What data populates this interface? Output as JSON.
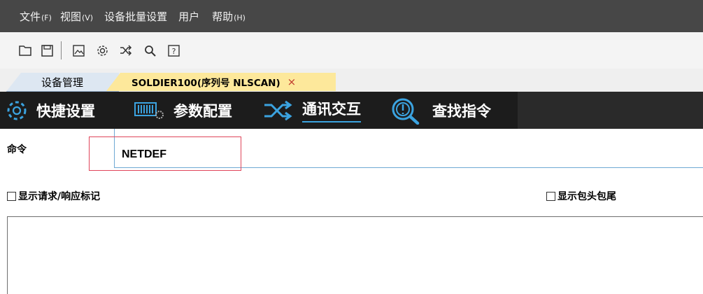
{
  "menu": [
    {
      "label": "文件",
      "accel": "(F)"
    },
    {
      "label": "视图",
      "accel": "(V)"
    },
    {
      "label": "设备批量设置",
      "accel": ""
    },
    {
      "label": "用户",
      "accel": ""
    },
    {
      "label": "帮助",
      "accel": "(H)"
    }
  ],
  "toolbar": {
    "icons": [
      "folder-icon",
      "save-icon",
      "image-icon",
      "gear-icon",
      "shuffle-icon",
      "search-icon",
      "help-icon"
    ]
  },
  "tabs": {
    "device_mgmt": "设备管理",
    "active_device": "SOLDIER100(序列号 NLSCAN)",
    "close": "×"
  },
  "function_tabs": [
    {
      "label": "快捷设置",
      "icon": "gear-icon"
    },
    {
      "label": "参数配置",
      "icon": "barcode-config-icon"
    },
    {
      "label": "通讯交互",
      "icon": "shuffle-icon",
      "active": true
    },
    {
      "label": "查找指令",
      "icon": "search-icon"
    }
  ],
  "command": {
    "label": "命令",
    "value": "NETDEF"
  },
  "options": {
    "show_req_resp": "显示请求/响应标记",
    "show_header_footer": "显示包头包尾"
  },
  "colors": {
    "menubar_bg": "#474747",
    "fbar_bg": "#1c1c1c",
    "active_tab_bg": "#fde89b",
    "highlight": "#e0455a",
    "accent": "#3ba3e0"
  }
}
